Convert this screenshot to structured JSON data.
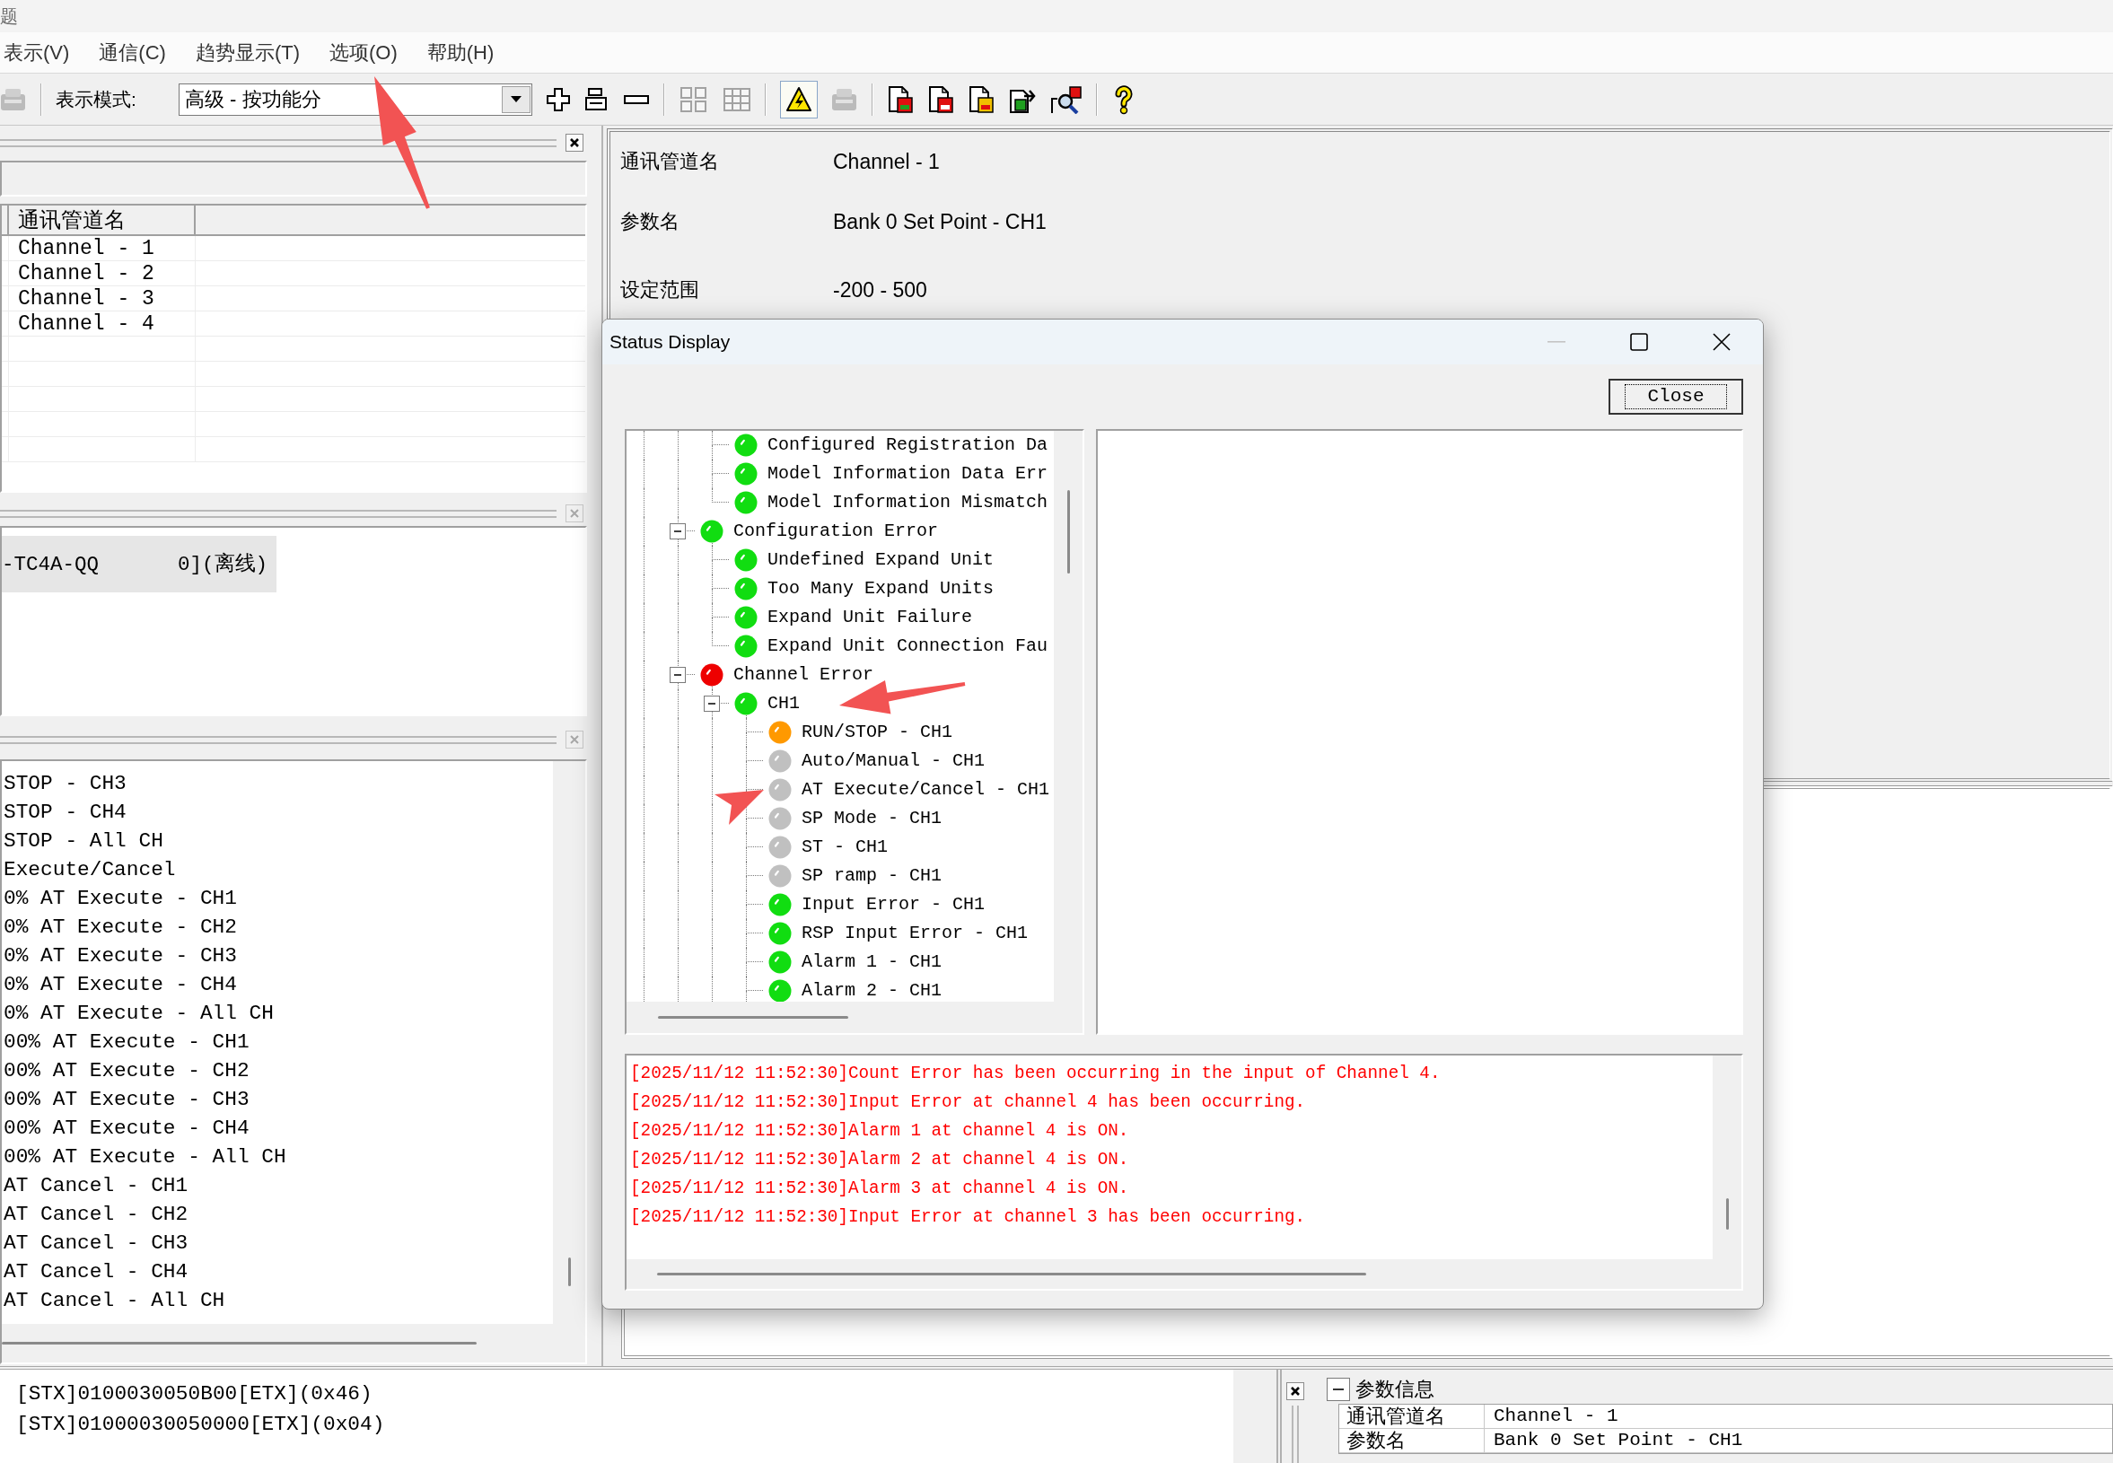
{
  "window": {
    "title": "题"
  },
  "menu": [
    "表示(V)",
    "通信(C)",
    "趋势显示(T)",
    "选项(O)",
    "帮助(H)"
  ],
  "toolbar": {
    "mode_label": "表示模式:",
    "mode_value": "高级 - 按功能分",
    "buttons": [
      {
        "disabled": true,
        "pressed": false
      },
      {
        "disabled": false,
        "pressed": false
      },
      {
        "disabled": false,
        "pressed": false
      },
      {
        "disabled": false,
        "pressed": false
      },
      {
        "disabled": true,
        "pressed": false
      },
      {
        "disabled": true,
        "pressed": false
      },
      {
        "disabled": false,
        "pressed": true
      },
      {
        "disabled": true,
        "pressed": false
      },
      {
        "disabled": false,
        "pressed": false
      },
      {
        "disabled": false,
        "pressed": false
      },
      {
        "disabled": false,
        "pressed": false
      },
      {
        "disabled": false,
        "pressed": false
      },
      {
        "disabled": false,
        "pressed": false
      },
      {
        "disabled": false,
        "pressed": false
      }
    ]
  },
  "channel_pane": {
    "active": true,
    "header": "通讯管道名",
    "rows": [
      "Channel - 1",
      "Channel - 2",
      "Channel - 3",
      "Channel - 4"
    ]
  },
  "device_pane": {
    "active": false,
    "rows": [
      {
        "cells": [
          "-TC4A-QQ",
          "0](离线)"
        ],
        "selected": true
      }
    ]
  },
  "command_pane": {
    "active": false,
    "rows": [
      "STOP - CH3",
      "STOP - CH4",
      "STOP - All CH",
      "Execute/Cancel",
      "0% AT Execute - CH1",
      "0% AT Execute - CH2",
      "0% AT Execute - CH3",
      "0% AT Execute - CH4",
      "0% AT Execute - All CH",
      "00% AT Execute - CH1",
      "00% AT Execute - CH2",
      "00% AT Execute - CH3",
      "00% AT Execute - CH4",
      "00% AT Execute - All CH",
      "AT Cancel - CH1",
      "AT Cancel - CH2",
      "AT Cancel - CH3",
      "AT Cancel - CH4",
      "AT Cancel - All CH"
    ]
  },
  "parameter_view": {
    "rows": [
      {
        "label": "通讯管道名",
        "value": "Channel - 1"
      },
      {
        "label": "参数名",
        "value": "Bank 0 Set Point - CH1"
      },
      {
        "label": "设定范围",
        "value": "-200 - 500"
      }
    ]
  },
  "status_dialog": {
    "title": "Status Display",
    "minimize": {
      "disabled": true
    },
    "close_button": "Close",
    "tree": {
      "items": [
        {
          "children": [
            {
              "label": "Configured Registration Da",
              "color": "#11dd11"
            },
            {
              "label": "Model Information Data Err",
              "color": "#11dd11"
            },
            {
              "label": "Model Information Mismatch",
              "color": "#11dd11"
            }
          ]
        },
        {
          "label": "Configuration Error",
          "color": "#11dd11",
          "expanded": true,
          "children": [
            {
              "label": "Undefined Expand Unit",
              "color": "#11dd11"
            },
            {
              "label": "Too Many Expand Units",
              "color": "#11dd11"
            },
            {
              "label": "Expand Unit Failure",
              "color": "#11dd11"
            },
            {
              "label": "Expand Unit Connection Fau",
              "color": "#11dd11"
            }
          ]
        },
        {
          "label": "Channel Error",
          "color": "#ee0000",
          "expanded": true,
          "children": [
            {
              "label": "CH1",
              "color": "#11dd11",
              "expanded": true,
              "children": [
                {
                  "label": "RUN/STOP - CH1",
                  "color": "#ff9900"
                },
                {
                  "label": "Auto/Manual - CH1",
                  "color": "#c0c0c0"
                },
                {
                  "label": "AT Execute/Cancel - CH1",
                  "color": "#c0c0c0"
                },
                {
                  "label": "SP Mode - CH1",
                  "color": "#c0c0c0"
                },
                {
                  "label": "ST - CH1",
                  "color": "#c0c0c0"
                },
                {
                  "label": "SP ramp - CH1",
                  "color": "#c0c0c0"
                },
                {
                  "label": "Input Error - CH1",
                  "color": "#11dd11"
                },
                {
                  "label": "RSP Input Error - CH1",
                  "color": "#11dd11"
                },
                {
                  "label": "Alarm 1 - CH1",
                  "color": "#11dd11"
                },
                {
                  "label": "Alarm 2 - CH1",
                  "color": "#11dd11"
                }
              ]
            }
          ]
        }
      ]
    },
    "log": [
      "[2025/11/12 11:52:30]Count Error has been occurring in the input of Channel 4.",
      "[2025/11/12 11:52:30]Input Error at channel 4 has been occurring.",
      "[2025/11/12 11:52:30]Alarm 1 at channel 4 is ON.",
      "[2025/11/12 11:52:30]Alarm 2 at channel 4 is ON.",
      "[2025/11/12 11:52:30]Alarm 3 at channel 4 is ON.",
      "[2025/11/12 11:52:30]Input Error at channel 3 has been occurring."
    ]
  },
  "comm_log": [
    "[STX]0100030050B00[ETX](0x46)",
    "[STX]01000030050000[ETX](0x04)"
  ],
  "parameter_info": {
    "title": "参数信息",
    "expanded": true,
    "rows": [
      {
        "label": "通讯管道名",
        "value": "Channel - 1"
      },
      {
        "label": "参数名",
        "value": "Bank 0 Set Point - CH1"
      }
    ]
  }
}
